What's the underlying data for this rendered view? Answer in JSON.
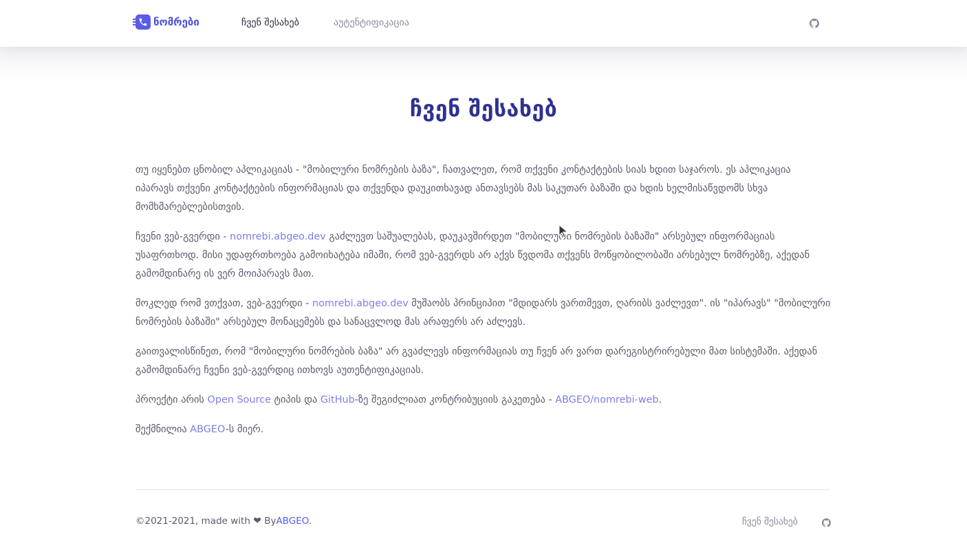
{
  "header": {
    "logo_text": "ნომრები",
    "nav": {
      "about": "ჩვენ შესახებ",
      "auth": "აუტენტიფიკაცია"
    }
  },
  "page": {
    "title": "ჩვენ შესახებ"
  },
  "content": {
    "p1": "თუ იყენებთ ცნობილ აპლიკაციას - \"მობილური ნომრების ბაზა\", ჩათვალეთ, რომ თქვენი კონტაქტების სიას ხდით საჯაროს. ეს აპლიკაცია იპარავს თქვენი კონტაქტების ინფორმაციას და თქვენდა დაუკითხავად ანთავსებს მას საკუთარ ბაზაში და ხდის ხელმისაწვდომს სხვა მომხმარებლებისთვის.",
    "p2_a": "ჩვენი ვებ-გვერდი - ",
    "p2_link": "nomrebi.abgeo.dev",
    "p2_b": " გაძლევთ საშუალებას, დაუკავშირდეთ \"მობილური ნომრების ბაზაში\" არსებულ ინფორმაციას უსაფრთხოდ. მისი უდაფრთხოება გამოიხატება იმაში, რომ ვებ-გვერდს არ აქვს წვდომა თქვენს მოწყობილობაში არსებულ ნომრებზე, აქედან გამომდინარე ის ვერ მოიპარავს მათ.",
    "p3_a": "მოკლედ რომ ვთქვათ, ვებ-გვერდი - ",
    "p3_link": "nomrebi.abgeo.dev",
    "p3_b": " მუშაობს პრინციპით \"მდიდარს ვართმევთ, ღარიბს ვაძლევთ\". ის \"იპარავს\" \"მობილური ნომრების ბაზაში\" არსებულ მონაცემებს და სანაცვლოდ მას არაფერს არ აძლევს.",
    "p4": "გაითვალისწინეთ, რომ \"მობილური ნომრების ბაზა\" არ გვაძლევს ინფორმაციას თუ ჩვენ არ ვართ დარეგისტრირებული მათ სისტემაში. აქედან გამომდინარე ჩვენი ვებ-გვერდიც ითხოვს აუთენტიფიკაციას.",
    "p5_a": "პროექტი არის ",
    "p5_link1": "Open Source",
    "p5_b": " ტიპის და ",
    "p5_link2": "GitHub",
    "p5_c": "-ზე შეგიძლიათ კონტრიბუციის გაკეთება - ",
    "p5_link3": "ABGEO/nomrebi-web",
    "p5_d": ".",
    "p6_a": "შექმნილია ",
    "p6_link": "ABGEO",
    "p6_b": "-ს მიერ."
  },
  "footer": {
    "copyright": "©2021-2021, made with",
    "heart_icon": "heart-icon",
    "by": " By",
    "author_link": "ABGEO",
    "period": ".",
    "about": "ჩვენ შესახებ"
  },
  "icons": {
    "logo": "phone-icon",
    "github": "github-icon"
  },
  "colors": {
    "accent": "#5b5ce6",
    "title": "#2f3190",
    "link": "#7c7fe4",
    "text": "#5a5a6e"
  }
}
